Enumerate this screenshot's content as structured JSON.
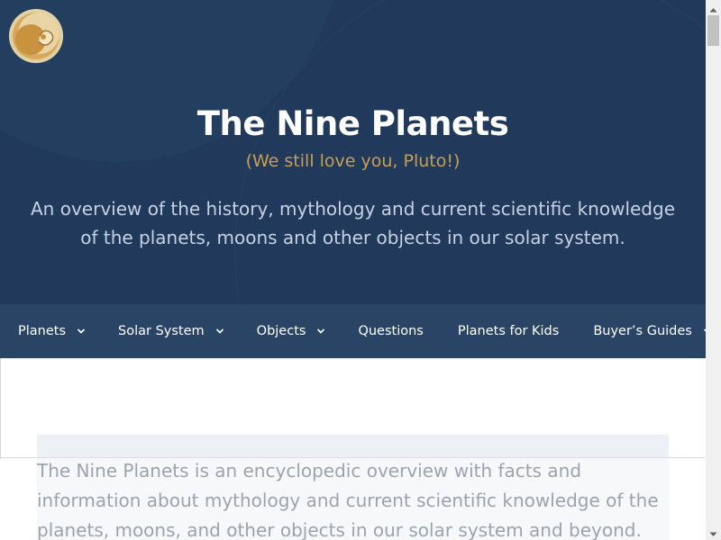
{
  "site": {
    "title": "The Nine Planets",
    "tagline": "(We still love you, Pluto!)",
    "description": "An overview of the history, mythology and current scientific knowledge of the planets, moons and other objects in our solar system."
  },
  "nav": {
    "items": [
      {
        "label": "Planets",
        "has_dropdown": true
      },
      {
        "label": "Solar System",
        "has_dropdown": true
      },
      {
        "label": "Objects",
        "has_dropdown": true
      },
      {
        "label": "Questions",
        "has_dropdown": false
      },
      {
        "label": "Planets for Kids",
        "has_dropdown": false
      },
      {
        "label": "Buyer’s Guides",
        "has_dropdown": true
      }
    ]
  },
  "content": {
    "intro": "The Nine Planets is an encyclopedic overview with facts and information about mythology and current scientific knowledge of the planets, moons, and other objects in our solar system and beyond."
  },
  "colors": {
    "header_bg": "#21395a",
    "nav_bg": "#2a4466",
    "tagline": "#c89f57",
    "description": "#c6d2e4"
  },
  "icons": {
    "logo": "planet-logo-icon",
    "dropdown": "chevron-down-icon"
  }
}
